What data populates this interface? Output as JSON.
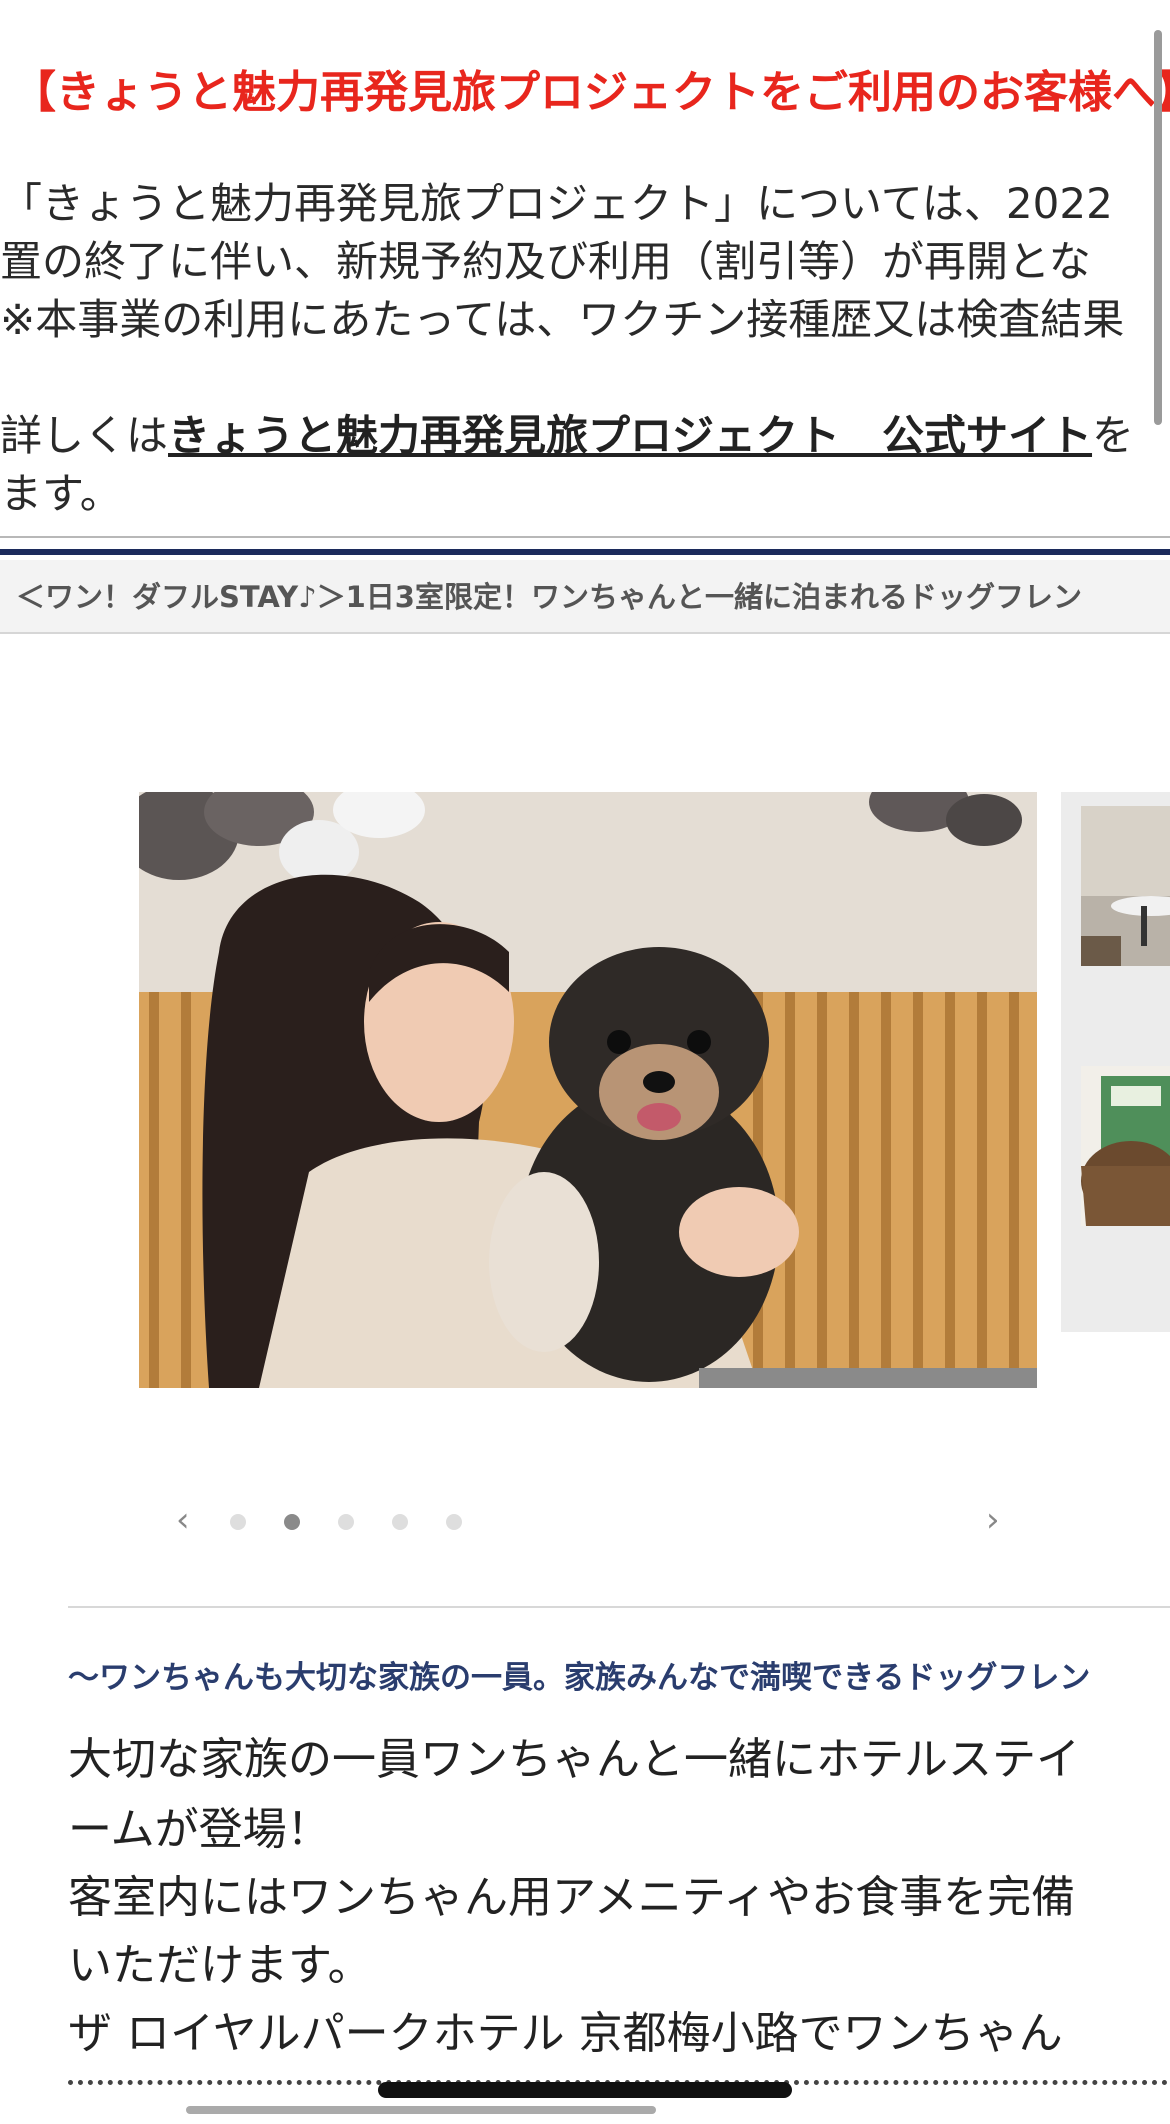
{
  "notice": {
    "title": "【きょうと魅力再発見旅プロジェクトをご利用のお客様へ】",
    "line1": "「きょうと魅力再発見旅プロジェクト」については、2022",
    "line2": "置の終了に伴い、新規予約及び利用（割引等）が再開とな",
    "line3": "※本事業の利用にあたっては、ワクチン接種歴又は検査結果",
    "line4_prefix": "詳しくは",
    "line4_link": "きょうと魅力再発見旅プロジェクト　公式サイト",
    "line4_suffix": "を",
    "line5": "ます。"
  },
  "plan_bar": {
    "title": "＜ワン！ダフルSTAY♪＞1日3室限定！ワンちゃんと一緒に泊まれるドッグフレン"
  },
  "gallery": {
    "prev_icon": "chevron-left-icon",
    "next_icon": "chevron-right-icon",
    "prev_glyph": "‹",
    "next_glyph": "›",
    "slide_count": 5,
    "active_index": 1
  },
  "description": {
    "catch": "〜ワンちゃんも大切な家族の一員。家族みんなで満喫できるドッグフレン",
    "line1": "大切な家族の一員ワンちゃんと一緒にホテルステイ",
    "line2": "ームが登場！",
    "line3": "客室内にはワンちゃん用アメニティやお食事を完備",
    "line4": "いただけます。",
    "line5": "ザ ロイヤルパークホテル 京都梅小路でワンちゃん"
  },
  "colors": {
    "notice_red": "#e8261d",
    "navy": "#1c2b5c",
    "catch_blue": "#2a3d6e"
  }
}
